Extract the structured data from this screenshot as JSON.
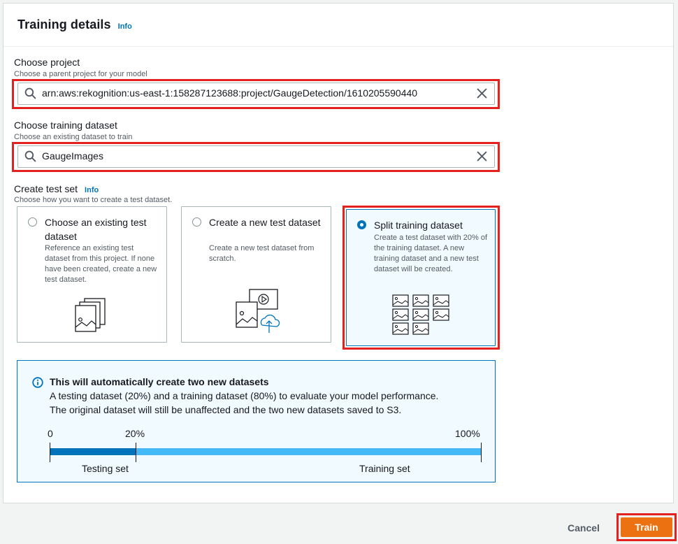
{
  "panel": {
    "title": "Training details",
    "info_label": "Info"
  },
  "project": {
    "label": "Choose project",
    "description": "Choose a parent project for your model",
    "value": "arn:aws:rekognition:us-east-1:158287123688:project/GaugeDetection/1610205590440"
  },
  "dataset": {
    "label": "Choose training dataset",
    "description": "Choose an existing dataset to train",
    "value": "GaugeImages"
  },
  "test_set": {
    "label": "Create test set",
    "info_label": "Info",
    "description": "Choose how you want to create a test dataset.",
    "selected_index": 2,
    "options": [
      {
        "title": "Choose an existing test dataset",
        "description": "Reference an existing test dataset from this project. If none have been created, create a new test dataset."
      },
      {
        "title": "Create a new test dataset",
        "description": "Create a new test dataset from scratch."
      },
      {
        "title": "Split training dataset",
        "description": "Create a test dataset with 20% of the training dataset. A new training dataset and a new test dataset will be created."
      }
    ]
  },
  "alert": {
    "title": "This will automatically create two new datasets",
    "line1": "A testing dataset (20%) and a training dataset (80%) to evaluate your model performance.",
    "line2": "The original dataset will still be unaffected and the two new datasets saved to S3.",
    "split": {
      "start_label": "0",
      "split_label": "20%",
      "end_label": "100%",
      "testing_fraction": 0.2,
      "testing_label": "Testing set",
      "training_label": "Training set",
      "testing_color": "#0073bb",
      "training_color": "#44b9f6"
    }
  },
  "footer": {
    "cancel_label": "Cancel",
    "train_label": "Train"
  },
  "colors": {
    "accent": "#0073bb",
    "primary_button": "#ec7211",
    "highlight_frame": "#e3211f"
  },
  "icons": [
    "search-icon",
    "clear-icon",
    "info-circle-icon",
    "stacked-images-icon",
    "upload-images-icon",
    "image-grid-icon"
  ]
}
